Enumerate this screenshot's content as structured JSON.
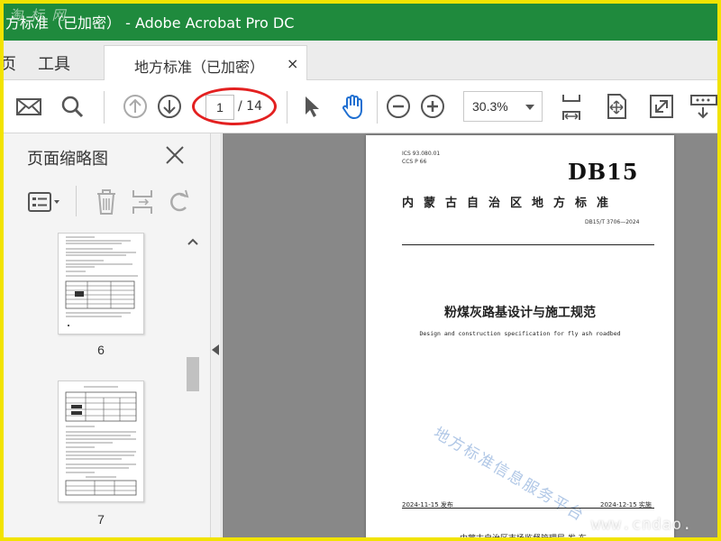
{
  "window": {
    "title": "方标准（已加密） - Adobe Acrobat Pro DC",
    "watermark": "淘 标 网"
  },
  "menu": {
    "items": [
      "页",
      "工具"
    ]
  },
  "tab": {
    "label": "地方标准（已加密）",
    "close": "×"
  },
  "toolbar": {
    "current_page": "1",
    "total_pages": "/ 14",
    "zoom": "30.3%"
  },
  "left_pane": {
    "title": "页面缩略图",
    "thumbnails": [
      {
        "number": "6"
      },
      {
        "number": "7"
      }
    ]
  },
  "document": {
    "ics": "ICS  93.080.01",
    "ccs": "CCS  P 66",
    "code": "DB15",
    "standard_type": "内蒙古自治区地方标准",
    "standard_number": "DB15/T 3706—2024",
    "title_cn": "粉煤灰路基设计与施工规范",
    "title_en": "Design and construction specification for fly ash roadbed",
    "watermark": "地方标准信息服务平台",
    "issue_date": "2024-11-15 发布",
    "implement_date": "2024-12-15 实施",
    "publisher": "内蒙古自治区市场监督管理局    发 布"
  },
  "site_watermark": "www.cndao.",
  "colors": {
    "titlebar": "#1f8a3d",
    "frame": "#f2e300",
    "highlight": "#e32020",
    "hand_tool": "#1f6fd1",
    "doc_background": "#888888"
  },
  "icons": [
    "mail-icon",
    "search-icon",
    "arrow-up-icon",
    "arrow-down-icon",
    "pointer-icon",
    "hand-icon",
    "zoom-out-icon",
    "zoom-in-icon",
    "fit-width-icon",
    "fit-page-icon",
    "fullscreen-icon",
    "more-tools-icon",
    "close-icon",
    "options-icon",
    "delete-icon",
    "extract-icon",
    "rotate-icon"
  ]
}
